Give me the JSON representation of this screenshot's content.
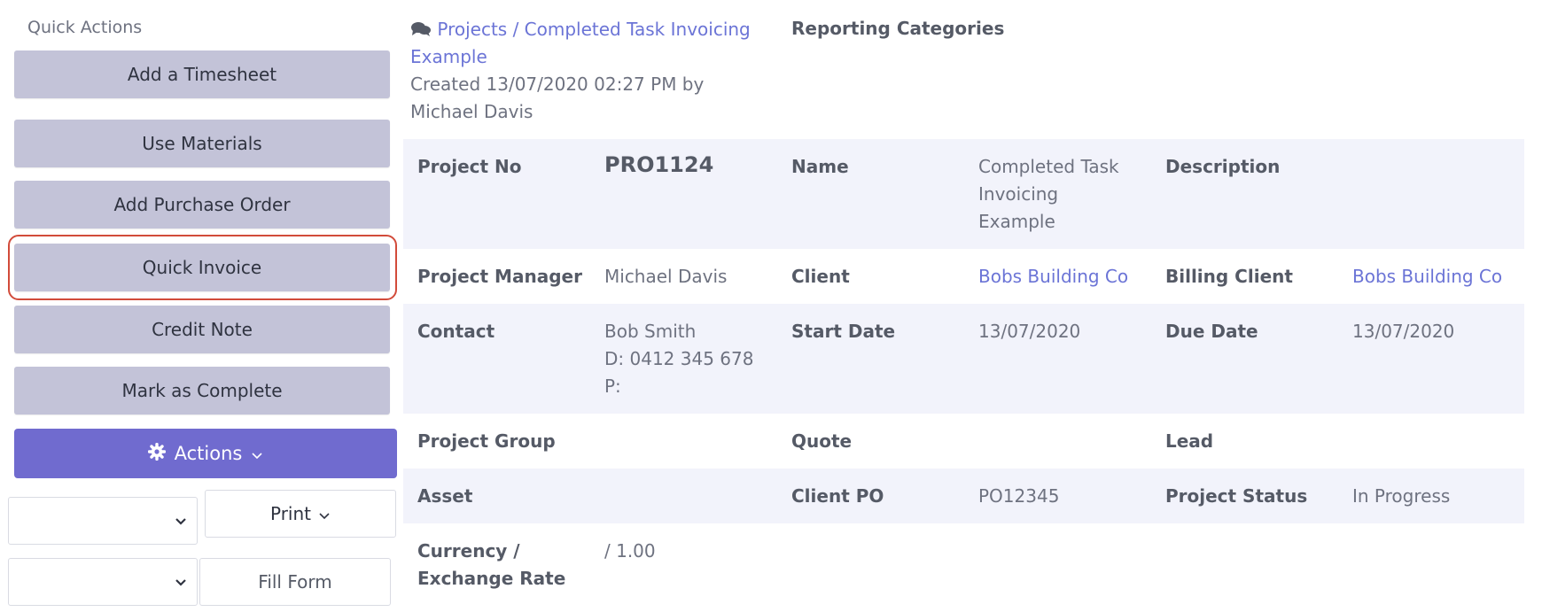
{
  "sidebar": {
    "title": "Quick Actions",
    "buttons": {
      "add_timesheet": "Add a Timesheet",
      "use_materials": "Use Materials",
      "add_purchase_order": "Add Purchase Order",
      "quick_invoice": "Quick Invoice",
      "credit_note": "Credit Note",
      "mark_complete": "Mark as Complete"
    },
    "actions_label": "Actions",
    "print_label": "Print",
    "fill_form_label": "Fill Form"
  },
  "header": {
    "breadcrumb": "Projects / Completed Task Invoicing Example",
    "created_meta": "Created 13/07/2020 02:27 PM by Michael Davis",
    "reporting_categories": "Reporting Categories"
  },
  "details": {
    "project_no": {
      "label": "Project No",
      "value": "PRO1124"
    },
    "name": {
      "label": "Name",
      "value": "Completed Task Invoicing Example"
    },
    "description": {
      "label": "Description",
      "value": ""
    },
    "project_manager": {
      "label": "Project Manager",
      "value": "Michael Davis"
    },
    "client": {
      "label": "Client",
      "value": "Bobs Building Co"
    },
    "billing_client": {
      "label": "Billing Client",
      "value": "Bobs Building Co"
    },
    "contact": {
      "label": "Contact",
      "name": "Bob Smith",
      "direct": "D: 0412 345 678",
      "phone": "P:"
    },
    "start_date": {
      "label": "Start Date",
      "value": "13/07/2020"
    },
    "due_date": {
      "label": "Due Date",
      "value": "13/07/2020"
    },
    "project_group": {
      "label": "Project Group",
      "value": ""
    },
    "quote": {
      "label": "Quote",
      "value": ""
    },
    "lead": {
      "label": "Lead",
      "value": ""
    },
    "asset": {
      "label": "Asset",
      "value": ""
    },
    "client_po": {
      "label": "Client PO",
      "value": "PO12345"
    },
    "project_status": {
      "label": "Project Status",
      "value": "In Progress"
    },
    "currency": {
      "label": "Currency / Exchange Rate",
      "value": "/ 1.00"
    }
  },
  "colors": {
    "accent": "#706bcf",
    "link": "#6b74d6",
    "button_bg": "#c3c3d8",
    "highlight": "#d24b3a",
    "row_shade": "#f2f3fb"
  },
  "icons": {
    "breadcrumb": "comments-icon",
    "actions": "gear-icon",
    "dropdown": "chevron-down-icon"
  }
}
